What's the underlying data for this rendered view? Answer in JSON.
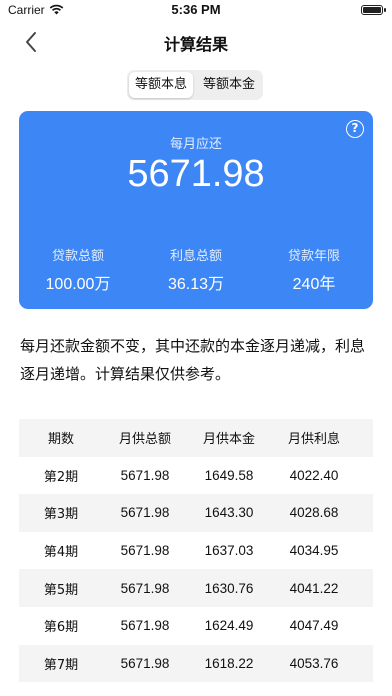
{
  "status_bar": {
    "carrier": "Carrier",
    "time": "5:36 PM",
    "battery_level": 1.0
  },
  "nav": {
    "title": "计算结果",
    "back_icon": "chevron-left-icon"
  },
  "segments": [
    {
      "label": "等额本息",
      "selected": true
    },
    {
      "label": "等额本金",
      "selected": false
    }
  ],
  "summary": {
    "monthly_label": "每月应还",
    "monthly_amount": "5671.98",
    "help_icon": "question-circle-icon",
    "help_glyph": "?",
    "stats": [
      {
        "label": "贷款总额",
        "value": "100.00万"
      },
      {
        "label": "利息总额",
        "value": "36.13万"
      },
      {
        "label": "贷款年限",
        "value": "240年"
      }
    ]
  },
  "note": "每月还款金额不变，其中还款的本金逐月递减，利息逐月递增。计算结果仅供参考。",
  "table": {
    "headers": [
      "期数",
      "月供总额",
      "月供本金",
      "月供利息"
    ],
    "rows": [
      [
        "第2期",
        "5671.98",
        "1649.58",
        "4022.40"
      ],
      [
        "第3期",
        "5671.98",
        "1643.30",
        "4028.68"
      ],
      [
        "第4期",
        "5671.98",
        "1637.03",
        "4034.95"
      ],
      [
        "第5期",
        "5671.98",
        "1630.76",
        "4041.22"
      ],
      [
        "第6期",
        "5671.98",
        "1624.49",
        "4047.49"
      ],
      [
        "第7期",
        "5671.98",
        "1618.22",
        "4053.76"
      ]
    ]
  },
  "colors": {
    "accent": "#3d86f5",
    "row_alt": "#f4f4f5"
  }
}
